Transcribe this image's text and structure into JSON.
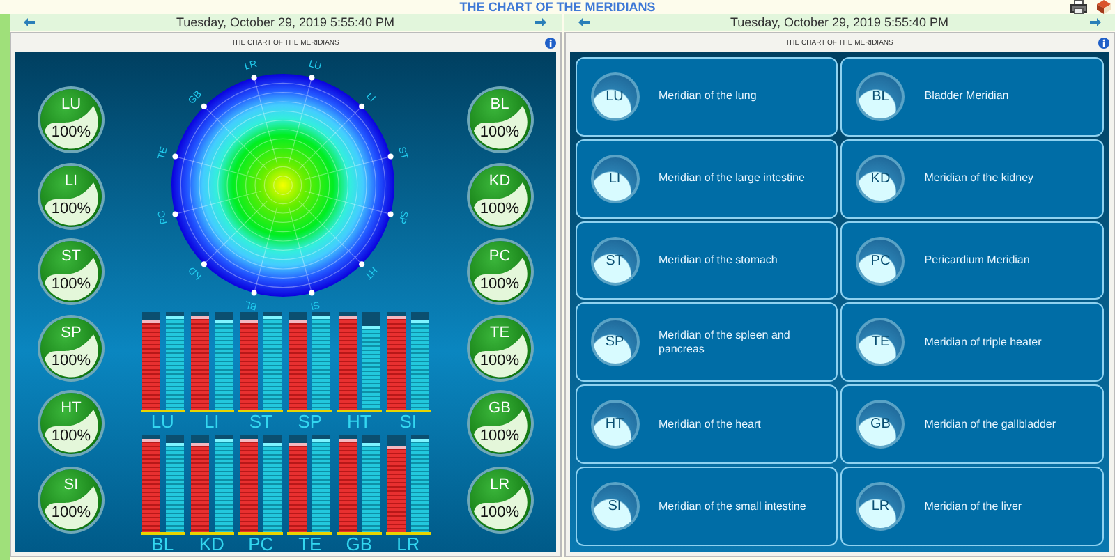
{
  "header": {
    "title": "THE CHART OF THE MERIDIANS"
  },
  "panels": [
    {
      "date": "Tuesday, October 29, 2019 5:55:40 PM",
      "title": "THE CHART OF THE MERIDIANS"
    },
    {
      "date": "Tuesday, October 29, 2019 5:55:40 PM",
      "title": "THE CHART OF THE MERIDIANS"
    }
  ],
  "badges_left": [
    {
      "code": "LU",
      "value": "100%"
    },
    {
      "code": "LI",
      "value": "100%"
    },
    {
      "code": "ST",
      "value": "100%"
    },
    {
      "code": "SP",
      "value": "100%"
    },
    {
      "code": "HT",
      "value": "100%"
    },
    {
      "code": "SI",
      "value": "100%"
    }
  ],
  "badges_right": [
    {
      "code": "BL",
      "value": "100%"
    },
    {
      "code": "KD",
      "value": "100%"
    },
    {
      "code": "PC",
      "value": "100%"
    },
    {
      "code": "TE",
      "value": "100%"
    },
    {
      "code": "GB",
      "value": "100%"
    },
    {
      "code": "LR",
      "value": "100%"
    }
  ],
  "radial_chart": {
    "labels": [
      "LU",
      "LI",
      "ST",
      "SP",
      "HT",
      "SI",
      "BL",
      "KD",
      "PC",
      "TE",
      "GB",
      "LR"
    ]
  },
  "bar_groups": [
    {
      "label": "LU",
      "bars": [
        {
          "kind": "red",
          "level": 0.95
        },
        {
          "kind": "cyan",
          "level": 1
        }
      ]
    },
    {
      "label": "LI",
      "bars": [
        {
          "kind": "red",
          "level": 1
        },
        {
          "kind": "cyan",
          "level": 0.96
        }
      ]
    },
    {
      "label": "ST",
      "bars": [
        {
          "kind": "red",
          "level": 0.95
        },
        {
          "kind": "cyan",
          "level": 1
        }
      ]
    },
    {
      "label": "SP",
      "bars": [
        {
          "kind": "red",
          "level": 0.95
        },
        {
          "kind": "cyan",
          "level": 1
        }
      ]
    },
    {
      "label": "HT",
      "bars": [
        {
          "kind": "red",
          "level": 1
        },
        {
          "kind": "cyan",
          "level": 0.9
        }
      ]
    },
    {
      "label": "SI",
      "bars": [
        {
          "kind": "red",
          "level": 1
        },
        {
          "kind": "cyan",
          "level": 0.96
        }
      ]
    },
    {
      "label": "BL",
      "bars": [
        {
          "kind": "red",
          "level": 1
        },
        {
          "kind": "cyan",
          "level": 0.96
        }
      ]
    },
    {
      "label": "KD",
      "bars": [
        {
          "kind": "red",
          "level": 0.96
        },
        {
          "kind": "cyan",
          "level": 1
        }
      ]
    },
    {
      "label": "PC",
      "bars": [
        {
          "kind": "red",
          "level": 1
        },
        {
          "kind": "cyan",
          "level": 0.96
        }
      ]
    },
    {
      "label": "TE",
      "bars": [
        {
          "kind": "red",
          "level": 0.96
        },
        {
          "kind": "cyan",
          "level": 1
        }
      ]
    },
    {
      "label": "GB",
      "bars": [
        {
          "kind": "red",
          "level": 1
        },
        {
          "kind": "cyan",
          "level": 0.96
        }
      ]
    },
    {
      "label": "LR",
      "bars": [
        {
          "kind": "red",
          "level": 0.92
        },
        {
          "kind": "cyan",
          "level": 1
        }
      ]
    }
  ],
  "cards": [
    {
      "code": "LU",
      "name": "Meridian of the lung"
    },
    {
      "code": "BL",
      "name": "Bladder Meridian"
    },
    {
      "code": "LI",
      "name": "Meridian of the large intestine"
    },
    {
      "code": "KD",
      "name": "Meridian of the kidney"
    },
    {
      "code": "ST",
      "name": "Meridian of the stomach"
    },
    {
      "code": "PC",
      "name": "Pericardium Meridian"
    },
    {
      "code": "SP",
      "name": "Meridian of the spleen and pancreas"
    },
    {
      "code": "TE",
      "name": "Meridian of triple heater"
    },
    {
      "code": "HT",
      "name": "Meridian of the heart"
    },
    {
      "code": "GB",
      "name": "Meridian of the gallbladder"
    },
    {
      "code": "SI",
      "name": "Meridian of the small intestine"
    },
    {
      "code": "LR",
      "name": "Meridian of the liver"
    }
  ]
}
